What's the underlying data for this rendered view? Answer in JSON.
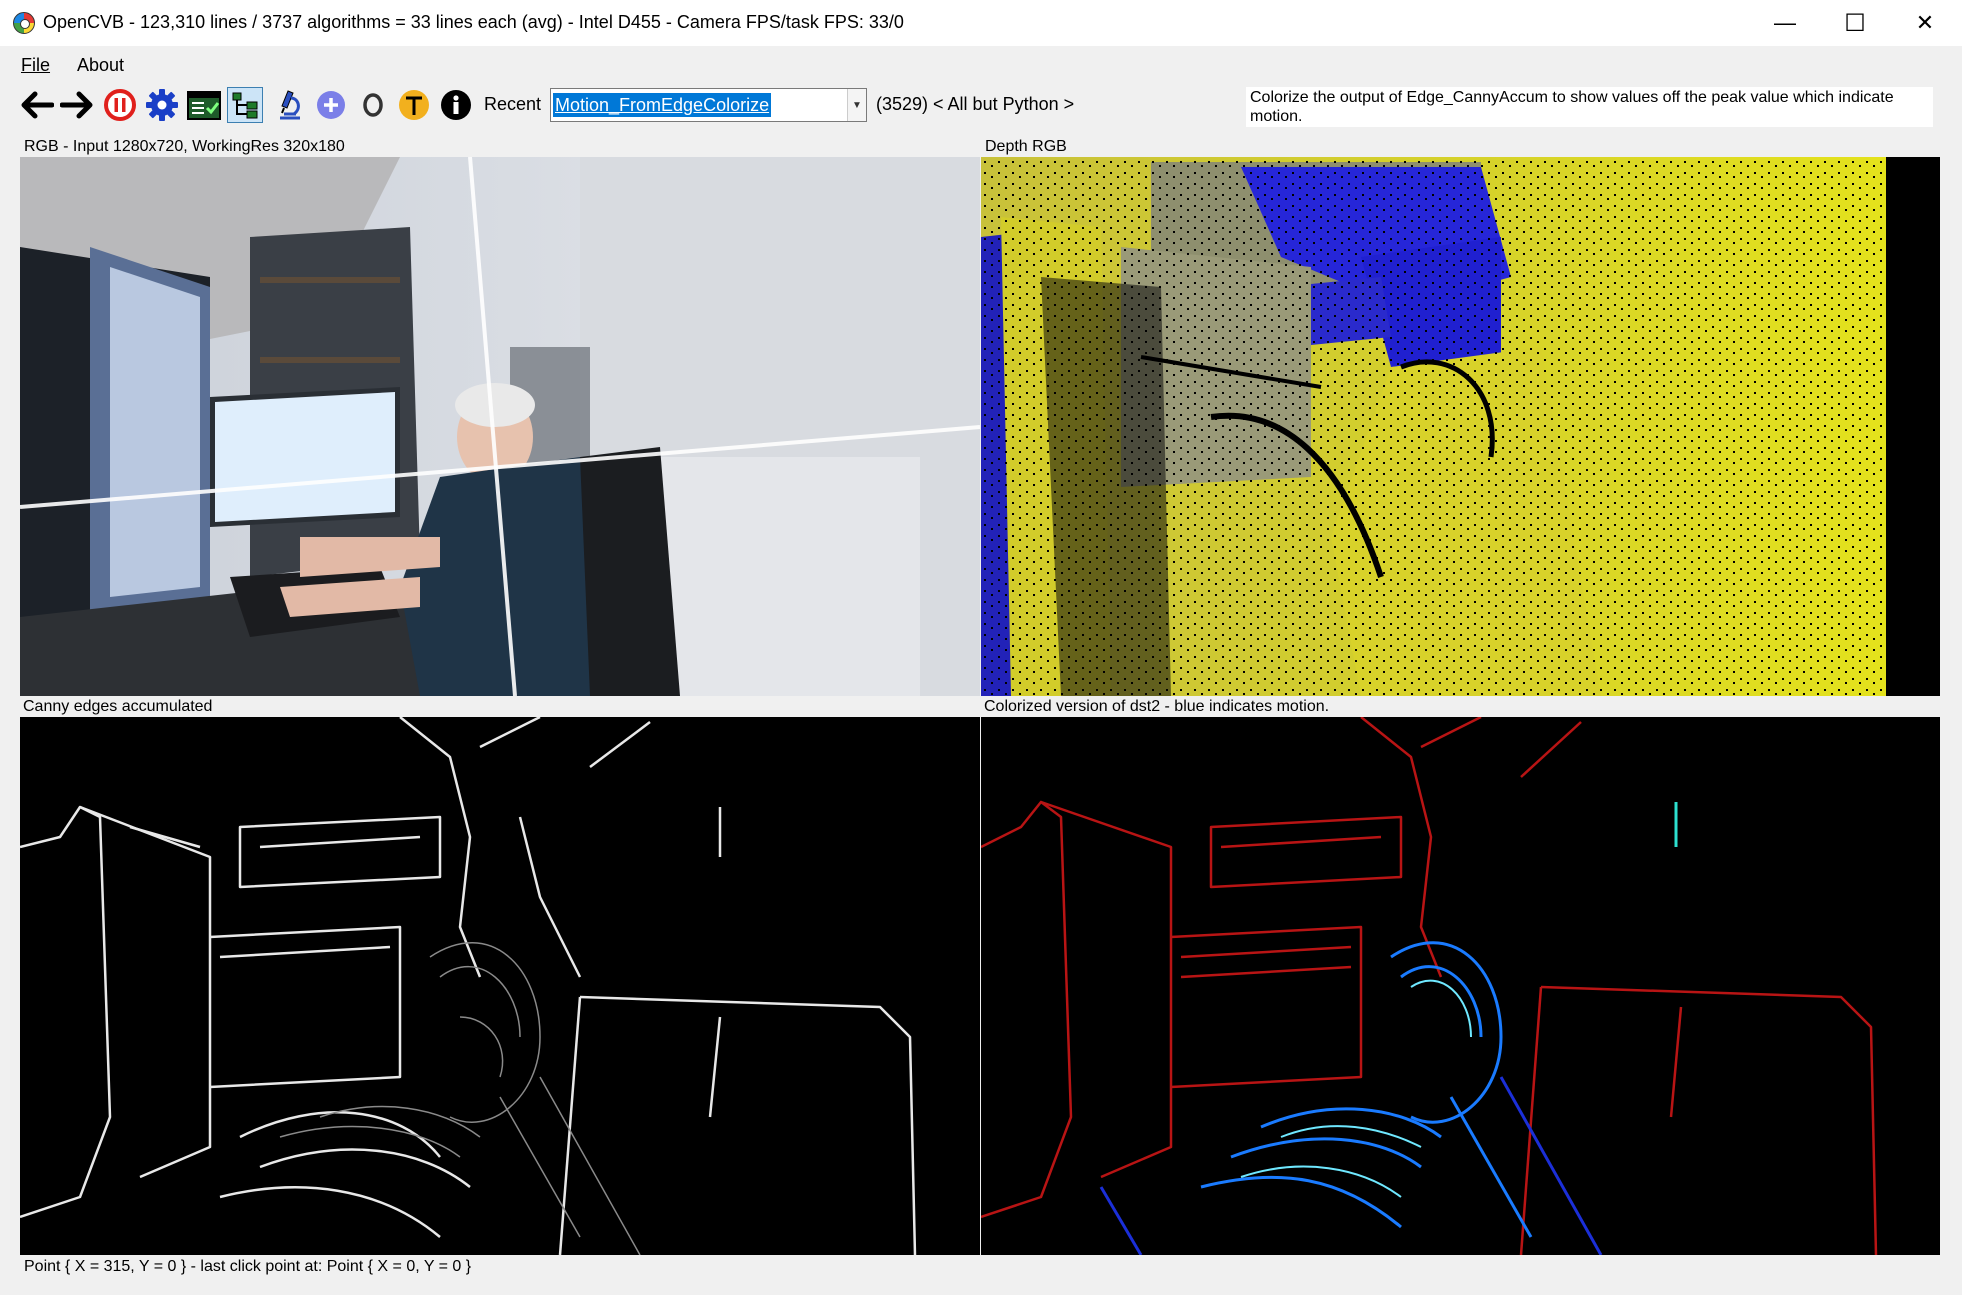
{
  "window": {
    "title": "OpenCVB - 123,310 lines / 3737 algorithms = 33 lines each (avg) - Intel D455 - Camera FPS/task FPS: 33/0",
    "minimize": "—",
    "maximize": "☐",
    "close": "✕"
  },
  "menu": {
    "file": "File",
    "about": "About"
  },
  "toolbar": {
    "recent_label": "Recent",
    "algorithm_selected": "Motion_FromEdgeColorize",
    "group_label": "(3529) < All but Python >",
    "description": "Colorize the output of Edge_CannyAccum to show values off the peak value which indicate motion."
  },
  "panels": {
    "top_left_caption": "RGB - Input 1280x720, WorkingRes 320x180",
    "top_right_caption": "Depth RGB",
    "bottom_left_caption": "Canny edges accumulated",
    "bottom_right_caption": "Colorized version of dst2 - blue indicates motion."
  },
  "status_text": "Point { X = 315, Y = 0 } - last click point at: Point { X = 0, Y = 0 }",
  "colors": {
    "accent": "#0078d7",
    "pause_red": "#e0201c",
    "gear_blue": "#1a3fc7"
  }
}
